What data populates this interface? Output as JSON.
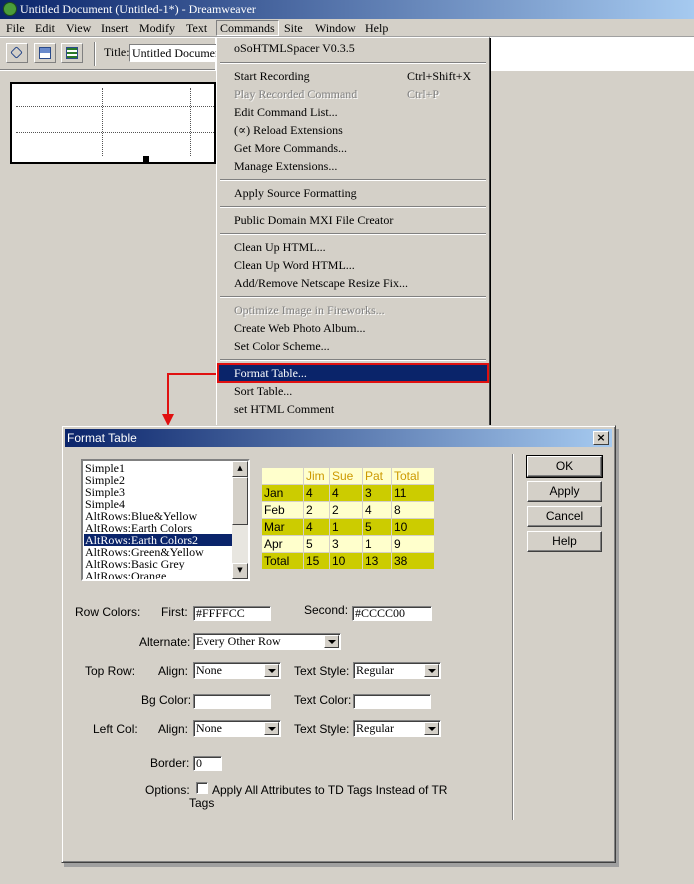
{
  "window": {
    "title": "Untitled Document (Untitled-1*) - Dreamweaver"
  },
  "menubar": [
    {
      "label": "File"
    },
    {
      "label": "Edit"
    },
    {
      "label": "View"
    },
    {
      "label": "Insert"
    },
    {
      "label": "Modify"
    },
    {
      "label": "Text"
    },
    {
      "label": "Commands"
    },
    {
      "label": "Site"
    },
    {
      "label": "Window"
    },
    {
      "label": "Help"
    }
  ],
  "toolbar": {
    "title_label": "Title:",
    "title_value": "Untitled Documen"
  },
  "commands_menu": {
    "items": [
      {
        "label": "oSoHTMLSpacer V0.3.5",
        "shortcut": "",
        "disabled": false
      },
      {
        "label": "Start Recording",
        "shortcut": "Ctrl+Shift+X",
        "disabled": false
      },
      {
        "label": "Play Recorded Command",
        "shortcut": "Ctrl+P",
        "disabled": true
      },
      {
        "label": "Edit Command List...",
        "shortcut": "",
        "disabled": false
      },
      {
        "label": "(∝) Reload Extensions",
        "shortcut": "",
        "disabled": false
      },
      {
        "label": "Get More Commands...",
        "shortcut": "",
        "disabled": false
      },
      {
        "label": "Manage Extensions...",
        "shortcut": "",
        "disabled": false
      },
      {
        "label": "Apply Source Formatting",
        "shortcut": "",
        "disabled": false
      },
      {
        "label": "Public Domain MXI File Creator",
        "shortcut": "",
        "disabled": false
      },
      {
        "label": "Clean Up HTML...",
        "shortcut": "",
        "disabled": false
      },
      {
        "label": "Clean Up Word HTML...",
        "shortcut": "",
        "disabled": false
      },
      {
        "label": "Add/Remove Netscape Resize Fix...",
        "shortcut": "",
        "disabled": false
      },
      {
        "label": "Optimize Image in Fireworks...",
        "shortcut": "",
        "disabled": true
      },
      {
        "label": "Create Web Photo Album...",
        "shortcut": "",
        "disabled": false
      },
      {
        "label": "Set Color Scheme...",
        "shortcut": "",
        "disabled": false
      },
      {
        "label": "Format Table...",
        "shortcut": "",
        "disabled": false,
        "highlighted": true
      },
      {
        "label": "Sort Table...",
        "shortcut": "",
        "disabled": false
      },
      {
        "label": "set HTML Comment",
        "shortcut": "",
        "disabled": false
      }
    ]
  },
  "dialog": {
    "title": "Format Table",
    "close_label": "×",
    "style_list": [
      "Simple1",
      "Simple2",
      "Simple3",
      "Simple4",
      "AltRows:Blue&Yellow",
      "AltRows:Earth Colors",
      "AltRows:Earth Colors2",
      "AltRows:Green&Yellow",
      "AltRows:Basic Grey",
      "AltRows:Orange"
    ],
    "style_selected": "AltRows:Earth Colors2",
    "preview_table": {
      "header": [
        "",
        "Jim",
        "Sue",
        "Pat",
        "Total"
      ],
      "rows": [
        [
          "Jan",
          "4",
          "4",
          "3",
          "11"
        ],
        [
          "Feb",
          "2",
          "2",
          "4",
          "8"
        ],
        [
          "Mar",
          "4",
          "1",
          "5",
          "10"
        ],
        [
          "Apr",
          "5",
          "3",
          "1",
          "9"
        ],
        [
          "Total",
          "15",
          "10",
          "13",
          "38"
        ]
      ],
      "row_colors": {
        "light": "#FFFFCC",
        "dark": "#CCCC00",
        "header_text": "#CC9900"
      }
    },
    "buttons": {
      "ok": "OK",
      "apply": "Apply",
      "cancel": "Cancel",
      "help": "Help"
    },
    "row_colors": {
      "label": "Row Colors:",
      "first_label": "First:",
      "first_value": "#FFFFCC",
      "second_label": "Second:",
      "second_value": "#CCCC00"
    },
    "alternate": {
      "label": "Alternate:",
      "value": "Every Other Row"
    },
    "top_row": {
      "label": "Top Row:",
      "align_label": "Align:",
      "align_value": "None",
      "text_style_label": "Text Style:",
      "text_style_value": "Regular",
      "bg_color_label": "Bg Color:",
      "bg_color_value": "",
      "text_color_label": "Text Color:",
      "text_color_value": ""
    },
    "left_col": {
      "label": "Left Col:",
      "align_label": "Align:",
      "align_value": "None",
      "text_style_label": "Text Style:",
      "text_style_value": "Regular"
    },
    "border": {
      "label": "Border:",
      "value": "0"
    },
    "options": {
      "label": "Options:",
      "checkbox_label_line1": "Apply All Attributes to TD Tags Instead of TR",
      "checkbox_label_line2": "Tags"
    }
  }
}
